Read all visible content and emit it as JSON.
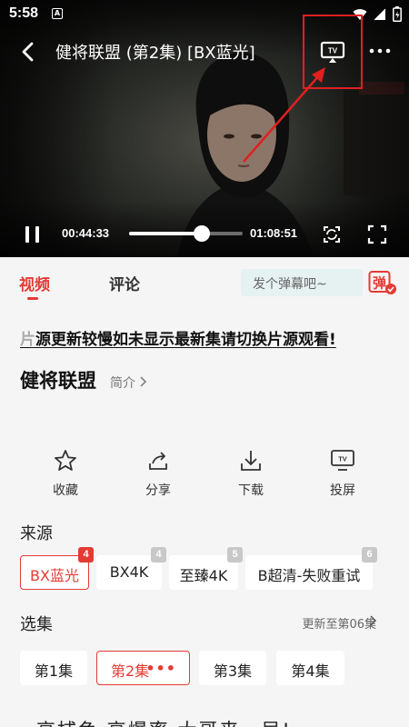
{
  "status_bar": {
    "time": "5:58",
    "notification_icon": "A"
  },
  "player": {
    "title": "健将联盟 (第2集) [BX蓝光]",
    "current_time": "00:44:33",
    "duration": "01:08:51",
    "progress_fraction": 0.64,
    "cast_icon_text": "TV"
  },
  "tabs": {
    "video": "视频",
    "comments": "评论"
  },
  "danmu": {
    "placeholder": "发个弹幕吧~",
    "button_text": "弹"
  },
  "notice": {
    "first_char": "片",
    "rest": "源更新较慢如未显示最新集请切换片源观看!"
  },
  "show": {
    "title": "健将联盟",
    "intro_label": "简介"
  },
  "actions": [
    {
      "label": "收藏",
      "icon": "star-icon"
    },
    {
      "label": "分享",
      "icon": "share-icon"
    },
    {
      "label": "下载",
      "icon": "download-icon"
    },
    {
      "label": "投屏",
      "icon": "tv-icon",
      "icon_text": "TV"
    }
  ],
  "sources": {
    "heading": "来源",
    "items": [
      {
        "label": "BX蓝光",
        "badge": "4",
        "selected": true
      },
      {
        "label": "BX4K",
        "badge": "4",
        "selected": false
      },
      {
        "label": "至臻4K",
        "badge": "5",
        "selected": false
      },
      {
        "label": "B超清-失败重试",
        "badge": "6",
        "selected": false
      }
    ]
  },
  "episodes": {
    "heading": "选集",
    "update_info": "更新至第06集",
    "items": [
      {
        "label": "第1集",
        "selected": false
      },
      {
        "label": "第2集",
        "selected": true
      },
      {
        "label": "第3集",
        "selected": false
      },
      {
        "label": "第4集",
        "selected": false
      }
    ]
  },
  "cut_text": "高捕鱼 高爆率 大哥来一局!",
  "colors": {
    "accent": "#e43b33",
    "annotation": "#e02020",
    "danmu_bg": "#e6f1f1",
    "page_bg": "#f5f5f5"
  }
}
